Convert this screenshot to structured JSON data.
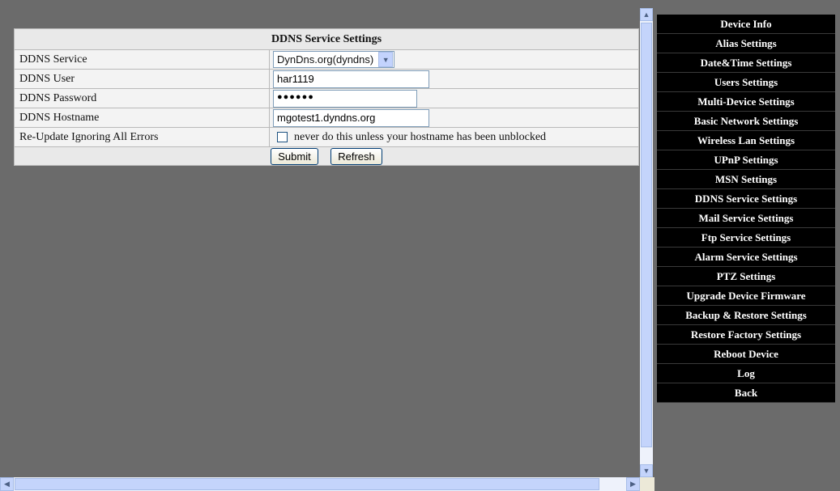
{
  "ddns": {
    "title": "DDNS Service Settings",
    "service": {
      "label": "DDNS Service",
      "selected": "DynDns.org(dyndns)"
    },
    "user": {
      "label": "DDNS User",
      "value": "har1119"
    },
    "password": {
      "label": "DDNS Password",
      "masked": "●●●●●●"
    },
    "hostname": {
      "label": "DDNS Hostname",
      "value": "mgotest1.dyndns.org"
    },
    "reupdate": {
      "label": "Re-Update Ignoring All Errors",
      "checked": false,
      "note": "never do this unless your hostname has been unblocked"
    },
    "submit_label": "Submit",
    "refresh_label": "Refresh"
  },
  "menu": [
    "Device Info",
    "Alias Settings",
    "Date&Time Settings",
    "Users Settings",
    "Multi-Device Settings",
    "Basic Network Settings",
    "Wireless Lan Settings",
    "UPnP Settings",
    "MSN Settings",
    "DDNS Service Settings",
    "Mail Service Settings",
    "Ftp Service Settings",
    "Alarm Service Settings",
    "PTZ Settings",
    "Upgrade Device Firmware",
    "Backup & Restore Settings",
    "Restore Factory Settings",
    "Reboot Device",
    "Log",
    "Back"
  ],
  "icons": {
    "select_arrow": "chevron-down-icon",
    "scroll_up": "arrow-up-icon",
    "scroll_down": "arrow-down-icon",
    "scroll_left": "arrow-left-icon",
    "scroll_right": "arrow-right-icon"
  }
}
